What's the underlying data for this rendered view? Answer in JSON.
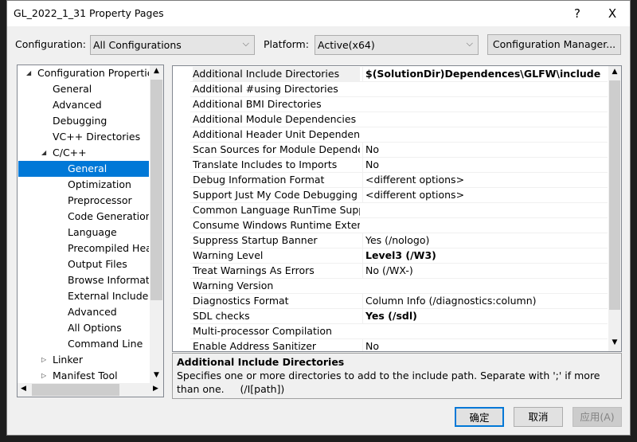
{
  "window": {
    "title": "GL_2022_1_31 Property Pages",
    "help": "?",
    "close": "X"
  },
  "toolbar": {
    "configuration_label": "Configuration:",
    "configuration_value": "All Configurations",
    "platform_label": "Platform:",
    "platform_value": "Active(x64)",
    "config_manager": "Configuration Manager..."
  },
  "tree": [
    {
      "label": "Configuration Properties",
      "level": 0,
      "arrow": "◢"
    },
    {
      "label": "General",
      "level": 1
    },
    {
      "label": "Advanced",
      "level": 1
    },
    {
      "label": "Debugging",
      "level": 1
    },
    {
      "label": "VC++ Directories",
      "level": 1
    },
    {
      "label": "C/C++",
      "level": 1,
      "arrow": "◢"
    },
    {
      "label": "General",
      "level": 2,
      "selected": true
    },
    {
      "label": "Optimization",
      "level": 2
    },
    {
      "label": "Preprocessor",
      "level": 2
    },
    {
      "label": "Code Generation",
      "level": 2
    },
    {
      "label": "Language",
      "level": 2
    },
    {
      "label": "Precompiled Headers",
      "level": 2
    },
    {
      "label": "Output Files",
      "level": 2
    },
    {
      "label": "Browse Information",
      "level": 2
    },
    {
      "label": "External Includes",
      "level": 2
    },
    {
      "label": "Advanced",
      "level": 2
    },
    {
      "label": "All Options",
      "level": 2
    },
    {
      "label": "Command Line",
      "level": 2
    },
    {
      "label": "Linker",
      "level": 1,
      "arrow": "▷"
    },
    {
      "label": "Manifest Tool",
      "level": 1,
      "arrow": "▷"
    }
  ],
  "properties": [
    {
      "name": "Additional Include Directories",
      "value": "$(SolutionDir)Dependences\\GLFW\\include",
      "bold": true,
      "selected": true
    },
    {
      "name": "Additional #using Directories",
      "value": ""
    },
    {
      "name": "Additional BMI Directories",
      "value": ""
    },
    {
      "name": "Additional Module Dependencies",
      "value": ""
    },
    {
      "name": "Additional Header Unit Dependencies",
      "value": ""
    },
    {
      "name": "Scan Sources for Module Dependencies",
      "value": "No"
    },
    {
      "name": "Translate Includes to Imports",
      "value": "No"
    },
    {
      "name": "Debug Information Format",
      "value": "<different options>"
    },
    {
      "name": "Support Just My Code Debugging",
      "value": "<different options>"
    },
    {
      "name": "Common Language RunTime Support",
      "value": ""
    },
    {
      "name": "Consume Windows Runtime Extension",
      "value": ""
    },
    {
      "name": "Suppress Startup Banner",
      "value": "Yes (/nologo)"
    },
    {
      "name": "Warning Level",
      "value": "Level3 (/W3)",
      "bold": true
    },
    {
      "name": "Treat Warnings As Errors",
      "value": "No (/WX-)"
    },
    {
      "name": "Warning Version",
      "value": ""
    },
    {
      "name": "Diagnostics Format",
      "value": "Column Info (/diagnostics:column)"
    },
    {
      "name": "SDL checks",
      "value": "Yes (/sdl)",
      "bold": true
    },
    {
      "name": "Multi-processor Compilation",
      "value": ""
    },
    {
      "name": "Enable Address Sanitizer",
      "value": "No"
    }
  ],
  "description": {
    "title": "Additional Include Directories",
    "text": "Specifies one or more directories to add to the include path. Separate with ';' if more than one.     (/I[path])"
  },
  "buttons": {
    "ok": "确定",
    "cancel": "取消",
    "apply": "应用(A)"
  },
  "colors": {
    "selection": "#0078d7",
    "dialog_bg": "#f0f0f0"
  }
}
